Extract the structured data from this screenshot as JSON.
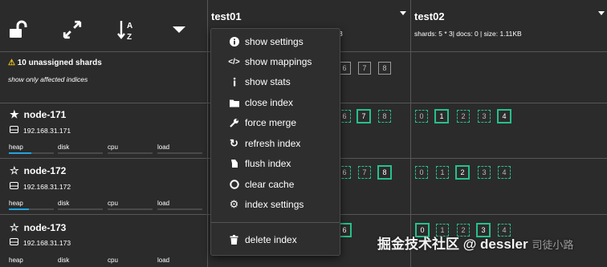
{
  "toolbar": {
    "unlock_icon": "lock-open-icon",
    "expand_icon": "arrows-expand-icon",
    "sort_icon": "sort-az-icon",
    "caret_icon": "caret-down-icon"
  },
  "indices": [
    {
      "name": "test01",
      "meta_partial": "3"
    },
    {
      "name": "test02",
      "meta": "shards: 5 * 3| docs: 0 | size: 1.11KB"
    }
  ],
  "unassigned": {
    "warning": "10 unassigned shards",
    "filter": "show only affected indices"
  },
  "nodes": [
    {
      "name": "node-171",
      "ip": "192.168.31.171",
      "star": "filled"
    },
    {
      "name": "node-172",
      "ip": "192.168.31.172",
      "star": "outline"
    },
    {
      "name": "node-173",
      "ip": "192.168.31.173",
      "star": "outline"
    }
  ],
  "metrics": {
    "heap": "heap",
    "disk": "disk",
    "cpu": "cpu",
    "load": "load"
  },
  "heap_usage": [
    0.5,
    0.45,
    0.45
  ],
  "shards": {
    "unassigned_test01": [
      "6",
      "7",
      "8"
    ],
    "test01_node171": [
      "6",
      "7",
      "8"
    ],
    "test02_node171": [
      "0",
      "1",
      "2",
      "3",
      "4"
    ],
    "test01_node172": [
      "6",
      "7",
      "8"
    ],
    "test02_node172": [
      "0",
      "1",
      "2",
      "3",
      "4"
    ],
    "test01_node173": [
      "6"
    ],
    "test02_node173": [
      "0",
      "1",
      "2",
      "3",
      "4"
    ]
  },
  "menu": {
    "items": [
      {
        "label": "show settings",
        "icon": "info-icon"
      },
      {
        "label": "show mappings",
        "icon": "code-icon"
      },
      {
        "label": "show stats",
        "icon": "info-small-icon"
      },
      {
        "label": "close index",
        "icon": "folder-icon"
      },
      {
        "label": "force merge",
        "icon": "wrench-icon"
      },
      {
        "label": "refresh index",
        "icon": "refresh-icon"
      },
      {
        "label": "flush index",
        "icon": "flush-icon"
      },
      {
        "label": "clear cache",
        "icon": "circle-icon"
      },
      {
        "label": "index settings",
        "icon": "gear-icon"
      }
    ],
    "danger": {
      "label": "delete index",
      "icon": "trash-icon"
    }
  },
  "watermark": {
    "text": "掘金技术社区 @ dessler",
    "soft": "司徒小路"
  },
  "colors": {
    "accent": "#27c08a",
    "heap_bar": "#23a4de",
    "background": "#2b2b2b"
  }
}
